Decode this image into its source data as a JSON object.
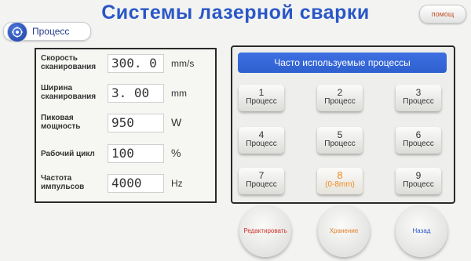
{
  "header": {
    "title": "Системы лазерной сварки",
    "help_label": "помощ"
  },
  "process_tab": {
    "label": "Процесс"
  },
  "parameters": [
    {
      "label": "Скорость сканирования",
      "value": "300. 0",
      "unit": "mm/s"
    },
    {
      "label": "Ширина сканирования",
      "value": "3. 00",
      "unit": "mm"
    },
    {
      "label": "Пиковая мощность",
      "value": "950",
      "unit": "W"
    },
    {
      "label": "Рабочий цикл",
      "value": "100",
      "unit": "%"
    },
    {
      "label": "Частота импульсов",
      "value": "4000",
      "unit": "Hz"
    }
  ],
  "process_panel": {
    "header": "Часто используемые процессы",
    "buttons": [
      {
        "number": "1",
        "label": "Процесс"
      },
      {
        "number": "2",
        "label": "Процесс"
      },
      {
        "number": "3",
        "label": "Процесс"
      },
      {
        "number": "4",
        "label": "Процесс"
      },
      {
        "number": "5",
        "label": "Процесс"
      },
      {
        "number": "6",
        "label": "Процесс"
      },
      {
        "number": "7",
        "label": "Процесс"
      },
      {
        "number": "8",
        "label": "(0-8mm)"
      },
      {
        "number": "9",
        "label": "Процесс"
      }
    ]
  },
  "actions": {
    "edit_label": "Редактировать",
    "save_label": "Хранение",
    "back_label": "Назад"
  },
  "colors": {
    "title": "#2a57c7",
    "header_bar": "#3d6fe2",
    "active_process": "#f08a1e",
    "edit": "#d2322a",
    "save": "#e2802a",
    "back": "#2a56c7"
  },
  "active_process_index": 8
}
